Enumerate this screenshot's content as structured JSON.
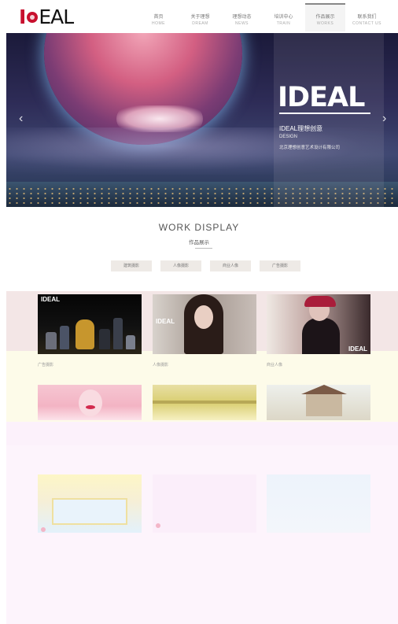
{
  "brand": {
    "logo_initial": "I",
    "logo_rest": "EAL"
  },
  "nav": [
    {
      "cn": "首页",
      "en": "HOME",
      "active": false
    },
    {
      "cn": "关于理想",
      "en": "DREAM",
      "active": false
    },
    {
      "cn": "理想动态",
      "en": "NEWS",
      "active": false
    },
    {
      "cn": "培训中心",
      "en": "TRAIN",
      "active": false
    },
    {
      "cn": "作品展示",
      "en": "WORKS",
      "active": true
    },
    {
      "cn": "联系我们",
      "en": "CONTACT US",
      "active": false
    }
  ],
  "hero": {
    "brand": "IDEAL",
    "tagline": "IDEAL理想创意",
    "sub": "DESIGN",
    "company": "北京理想创意艺术设计有限公司",
    "prev_arrow": "‹",
    "next_arrow": "›"
  },
  "section": {
    "title": "WORK DISPLAY",
    "subtitle": "作品展示"
  },
  "filters": [
    "建筑摄影",
    "人像摄影",
    "商业人像",
    "广告摄影"
  ],
  "gallery": {
    "captions": [
      "广告摄影",
      "人像摄影",
      "商业人像"
    ],
    "thumb1_logo": "IDEAL",
    "thumb2_logo": "IDEAL",
    "thumb3_logo": "IDEAL"
  },
  "colors": {
    "accent": "#c8102e",
    "filter_bg": "#eeeae6"
  }
}
